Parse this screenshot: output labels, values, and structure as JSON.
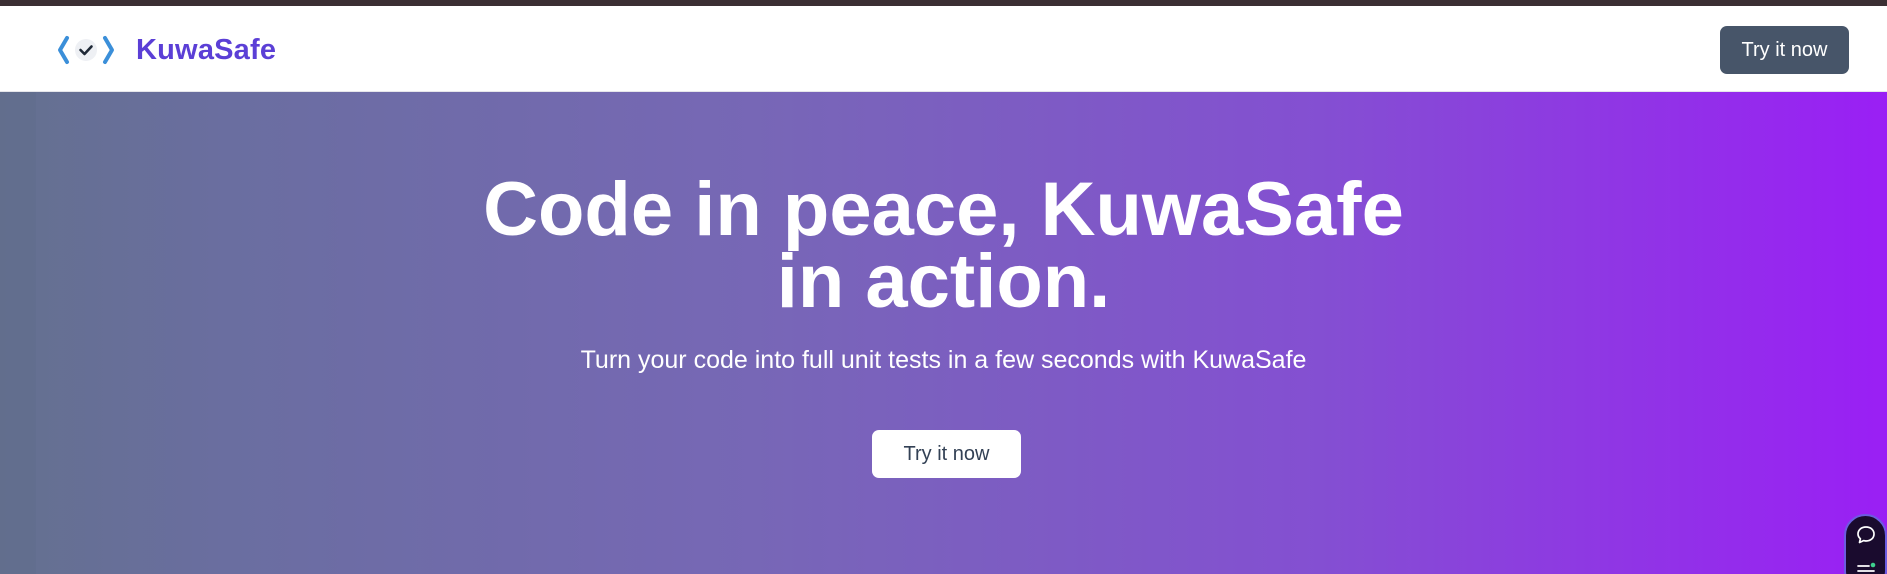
{
  "colors": {
    "brand": "#5b3fd6",
    "nav_button": "#475569",
    "hero_gradient_start": "#64708f",
    "hero_gradient_end": "#9a1ff5",
    "hero_button_text": "#334155"
  },
  "navbar": {
    "logo_icon": "code-check-icon",
    "brand_name": "KuwaSafe",
    "cta_label": "Try it now"
  },
  "hero": {
    "title_line1": "Code in peace, KuwaSafe",
    "title_line2": "in action.",
    "subtitle": "Turn your code into full unit tests in a few seconds with KuwaSafe",
    "cta_label": "Try it now"
  },
  "side_widget": {
    "chat_icon": "chat-bubble-icon",
    "menu_icon": "menu-list-icon"
  }
}
